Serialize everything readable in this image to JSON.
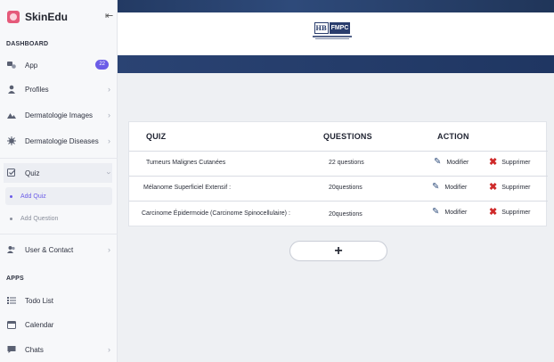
{
  "brand": {
    "name": "SkinEdu",
    "collapse_icon": "collapse-arrow-icon"
  },
  "sidebar": {
    "dashboard_label": "DASHBOARD",
    "apps_label": "APPS",
    "items": [
      {
        "label": "App",
        "icon": "apps-icon",
        "badge": "22"
      },
      {
        "label": "Profiles",
        "icon": "user-icon"
      },
      {
        "label": "Dermatologie Images",
        "icon": "image-icon"
      },
      {
        "label": "Dermatologie Diseases",
        "icon": "virus-icon"
      },
      {
        "label": "Quiz",
        "icon": "checkbox-icon"
      },
      {
        "label": "User & Contact",
        "icon": "contacts-icon"
      },
      {
        "label": "Todo List",
        "icon": "list-icon"
      },
      {
        "label": "Calendar",
        "icon": "calendar-icon"
      },
      {
        "label": "Chats",
        "icon": "chat-icon"
      }
    ],
    "quiz_sub": [
      {
        "label": "Add Quiz"
      },
      {
        "label": "Add Question"
      }
    ]
  },
  "header": {
    "logo_mark": "HB",
    "logo_text": "FMPC"
  },
  "table": {
    "headers": {
      "quiz": "QUIZ",
      "questions": "QUESTIONS",
      "action": "ACTION"
    },
    "rows": [
      {
        "quiz": "Tumeurs Malignes Cutanées",
        "questions": "22 questions",
        "modify": "Modifier",
        "delete": "Supprimer"
      },
      {
        "quiz": "Mélanome Superficiel Extensif :",
        "questions": "20questions",
        "modify": "Modifier",
        "delete": "Supprimer"
      },
      {
        "quiz": "Carcinome Épidermoide (Carcinome Spinocellulaire) :",
        "questions": "20questions",
        "modify": "Modifier",
        "delete": "Supprimer"
      }
    ]
  },
  "add_button": {
    "label": "+"
  },
  "colors": {
    "accent": "#6b5ce7",
    "navy": "#2a4373",
    "danger": "#cf2a2a"
  }
}
